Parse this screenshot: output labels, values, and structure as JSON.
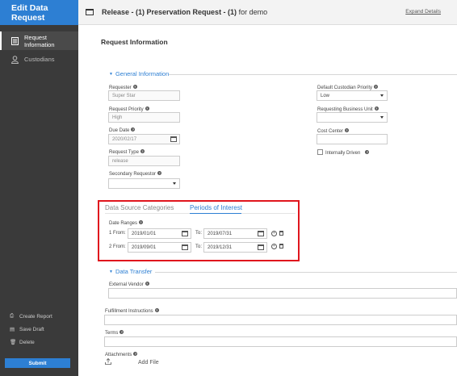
{
  "sidebar": {
    "title": "Edit Data Request",
    "items": [
      {
        "label": "Request Information",
        "icon": "document-icon"
      },
      {
        "label": "Custodians",
        "icon": "user-icon"
      }
    ],
    "actions": [
      {
        "label": "Create Report",
        "icon": "report-icon"
      },
      {
        "label": "Save Draft",
        "icon": "save-icon"
      },
      {
        "label": "Delete",
        "icon": "trash-icon"
      }
    ],
    "submit_label": "Submit"
  },
  "topbar": {
    "title_bold": "Release - (1) Preservation Request - (1)",
    "title_rest": " for demo",
    "expand_label": "Expand Details"
  },
  "main": {
    "title": "Request Information",
    "general": {
      "heading": "General Information",
      "requester": {
        "label": "Requester",
        "value": "Super Star"
      },
      "priority": {
        "label": "Request Priority",
        "value": "High"
      },
      "due_date": {
        "label": "Due Date",
        "value": "2020/02/17"
      },
      "request_type": {
        "label": "Request Type",
        "value": "release"
      },
      "secondary_requestor": {
        "label": "Secondary Requestor",
        "value": ""
      },
      "default_custodian_priority": {
        "label": "Default Custodian Priority",
        "value": "Low"
      },
      "requesting_business_unit": {
        "label": "Requesting Business Unit",
        "value": ""
      },
      "cost_center": {
        "label": "Cost Center",
        "value": ""
      },
      "internally_driven": {
        "label": "Internally Driven",
        "checked": false
      }
    },
    "tabs": {
      "items": [
        "Data Source Categories",
        "Periods of Interest"
      ],
      "active": 1
    },
    "date_ranges": {
      "label": "Date Ranges",
      "rows": [
        {
          "from_label": "1 From:",
          "from": "2019/01/01",
          "to_label": "To:",
          "to": "2019/07/31"
        },
        {
          "from_label": "2 From:",
          "from": "2019/09/01",
          "to_label": "To:",
          "to": "2019/12/31"
        }
      ]
    },
    "data_transfer": {
      "heading": "Data Transfer",
      "external_vendor": "External Vendor",
      "fulfillment": "Fulfillment Instructions",
      "terms": "Terms",
      "attachments": "Attachments",
      "add_file": "Add File"
    }
  },
  "colors": {
    "accent": "#2d7fd3",
    "sidebar_bg": "#3a3a3a",
    "highlight": "#e0161d"
  }
}
